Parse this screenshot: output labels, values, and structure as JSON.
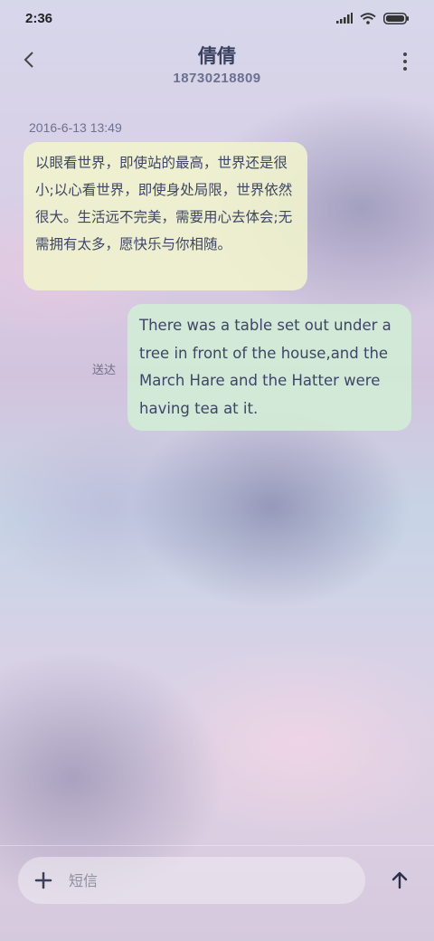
{
  "status_bar": {
    "time": "2:36",
    "icons": [
      "signal-icon",
      "wifi-icon",
      "battery-icon"
    ]
  },
  "header": {
    "back_icon": "chevron-left-icon",
    "contact_name": "倩倩",
    "contact_number": "18730218809",
    "more_icon": "more-vertical-icon"
  },
  "conversation": {
    "timestamp": "2016-6-13 13:49",
    "messages": [
      {
        "direction": "received",
        "text": "以眼看世界，即使站的最高，世界还是很小;以心看世界，即使身处局限，世界依然很大。生活远不完美，需要用心去体会;无需拥有太多，愿快乐与你相随。"
      },
      {
        "direction": "sent",
        "text": "There was a table set out under a tree in front of the house,and the March Hare and the Hatter were having tea at it.",
        "status": "送达"
      }
    ]
  },
  "compose": {
    "add_icon": "plus-icon",
    "placeholder": "短信",
    "value": "",
    "send_icon": "arrow-up-icon"
  },
  "colors": {
    "received_bubble": "#f0f4cd",
    "sent_bubble": "#d2ecd6",
    "text": "#3e4566"
  }
}
